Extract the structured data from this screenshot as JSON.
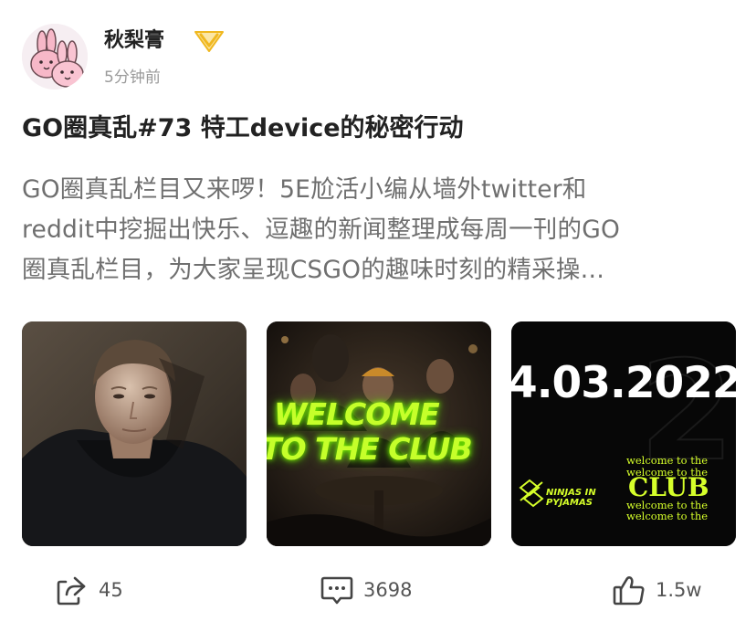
{
  "author": {
    "name": "秋梨膏",
    "avatar_icon": "bunny-avatar-icon",
    "badge_icon": "verified-v-icon",
    "badge_color": "#f0b820"
  },
  "timestamp": "5分钟前",
  "post": {
    "title": "GO圈真乱#73 特工device的秘密行动",
    "excerpt_lines": [
      "GO圈真乱栏目又来啰！5E尬活小编从墙外twitter和",
      "reddit中挖掘出快乐、逗趣的新闻整理成每周一刊的GO",
      "圈真乱栏目，为大家呈现CSGO的趣味时刻的精采操…"
    ]
  },
  "images": [
    {
      "description_icon": "player-portrait-image"
    },
    {
      "description_icon": "team-group-image",
      "line1": "WELCOME",
      "line2": "TO THE CLUB",
      "accent": "#c5ff2a"
    },
    {
      "description_icon": "nip-announcement-image",
      "date": "4.03.2022",
      "logo_line1": "NINJAS IN",
      "logo_line2": "PYJAMAS",
      "club_small_1": "welcome to the",
      "club_small_2": "welcome to the",
      "club_big": "CLUB",
      "club_small_3": "welcome to the",
      "club_small_4": "welcome to the",
      "accent": "#d6ff2a"
    }
  ],
  "actions": {
    "share": {
      "icon": "share-icon",
      "count": "45"
    },
    "comment": {
      "icon": "comment-icon",
      "count": "3698"
    },
    "like": {
      "icon": "thumbs-up-icon",
      "count": "1.5w"
    }
  }
}
